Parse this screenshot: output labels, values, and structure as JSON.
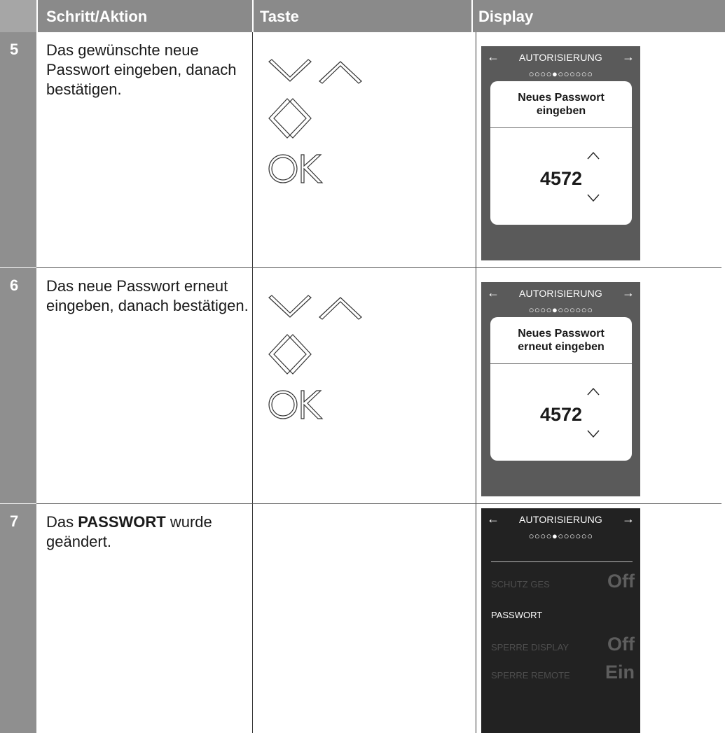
{
  "headers": {
    "num": "",
    "action": "Schritt/Aktion",
    "key": "Taste",
    "display": "Display"
  },
  "rows": [
    {
      "num": "5",
      "action": "Das gewünschte neue Passwort eingeben, danach bestätigen.",
      "keys": [
        "down-up-keys",
        "left-right-keys",
        "ok-key"
      ],
      "display": {
        "title": "AUTORISIERUNG",
        "arrow_left": "←",
        "arrow_right": "→",
        "dots": "○○○○●○○○○○○",
        "card_title_1": "Neues Passwort",
        "card_title_2": "eingeben",
        "value": "4572"
      }
    },
    {
      "num": "6",
      "action": "Das neue Passwort erneut eingeben, danach bestätigen.",
      "keys": [
        "down-up-keys",
        "left-right-keys",
        "ok-key"
      ],
      "display": {
        "title": "AUTORISIERUNG",
        "arrow_left": "←",
        "arrow_right": "→",
        "dots": "○○○○●○○○○○○",
        "card_title_1": "Neues Passwort",
        "card_title_2": "erneut eingeben",
        "value": "4572"
      }
    },
    {
      "num": "7",
      "action_prefix": "Das ",
      "action_bold": "PASSWORT",
      "action_suffix": " wurde geändert.",
      "display": {
        "title": "AUTORISIERUNG",
        "arrow_left": "←",
        "arrow_right": "→",
        "dots": "○○○○●○○○○○○",
        "items": [
          {
            "label": "SCHUTZ GES",
            "value": "Off"
          },
          {
            "label": "PASSWORT",
            "value": ""
          },
          {
            "label": "SPERRE DISPLAY",
            "value": "Off"
          },
          {
            "label": "SPERRE REMOTE",
            "value": "Ein"
          }
        ]
      }
    }
  ],
  "colors": {
    "header_bg": "#8a8a8a",
    "num_bg": "#8f8f8f",
    "display_grey": "#5a5a5a",
    "display_dark": "#222222"
  }
}
